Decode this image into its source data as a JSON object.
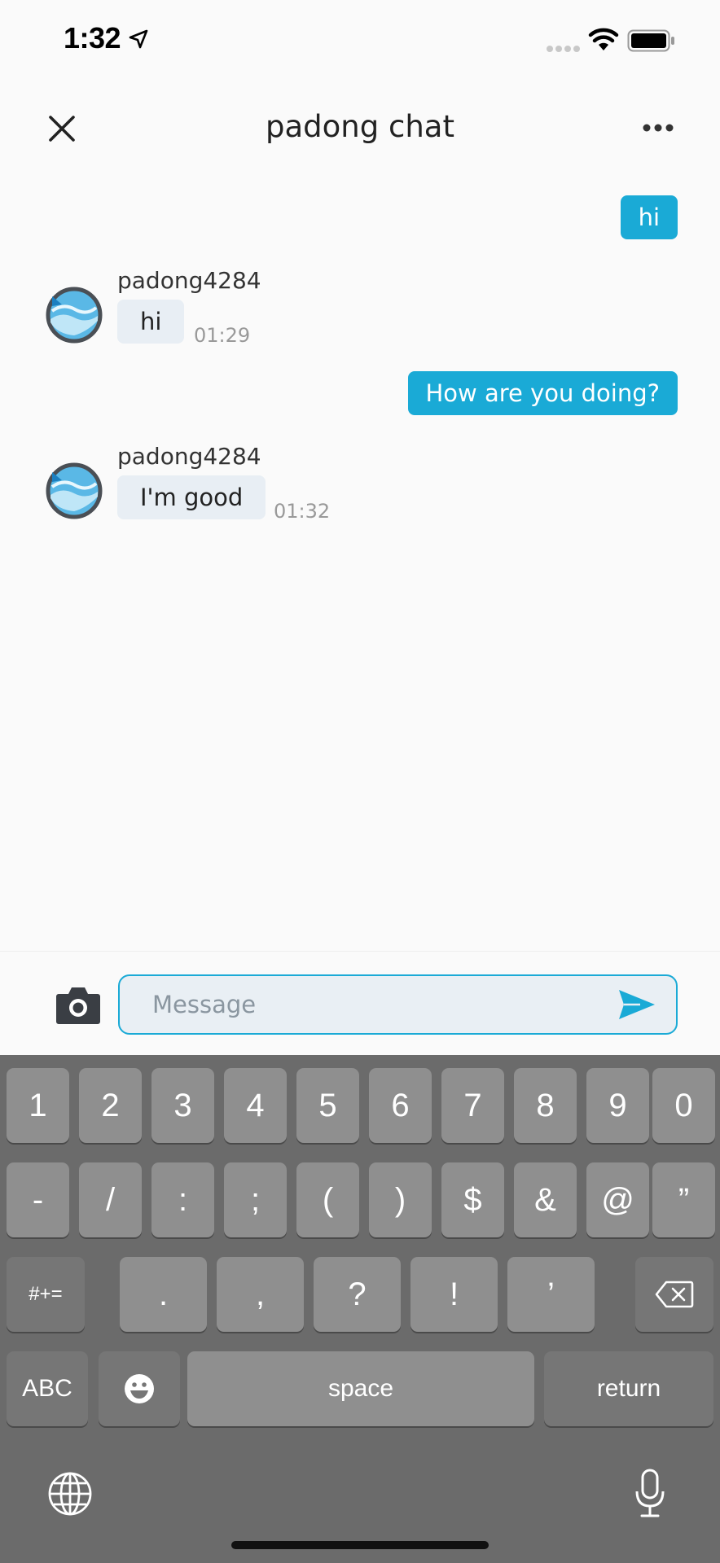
{
  "status_bar": {
    "time": "1:32"
  },
  "header": {
    "title": "padong chat"
  },
  "messages": [
    {
      "direction": "outgoing",
      "text": "hi"
    },
    {
      "direction": "incoming",
      "sender": "padong4284",
      "text": "hi",
      "time": "01:29"
    },
    {
      "direction": "outgoing",
      "text": "How are you doing?"
    },
    {
      "direction": "incoming",
      "sender": "padong4284",
      "text": "I'm good",
      "time": "01:32"
    }
  ],
  "composer": {
    "placeholder": "Message"
  },
  "keyboard": {
    "row1": [
      "1",
      "2",
      "3",
      "4",
      "5",
      "6",
      "7",
      "8",
      "9",
      "0"
    ],
    "row2": [
      "-",
      "/",
      ":",
      ";",
      "(",
      ")",
      "$",
      "&",
      "@",
      "”"
    ],
    "row3": [
      "#+=",
      ".",
      ",",
      "?",
      "!",
      "’"
    ],
    "row4": {
      "abc": "ABC",
      "space": "space",
      "return": "return"
    }
  },
  "colors": {
    "accent": "#1aaad6",
    "incoming_bubble": "#e8eef4",
    "keyboard_bg": "#6b6b6b",
    "key_bg": "#8f8f8f"
  },
  "icons": [
    "location-arrow-icon",
    "signal-icon",
    "wifi-icon",
    "battery-icon",
    "close-icon",
    "more-icon",
    "avatar-icon",
    "camera-icon",
    "send-icon",
    "backspace-icon",
    "emoji-icon",
    "globe-icon",
    "microphone-icon"
  ]
}
